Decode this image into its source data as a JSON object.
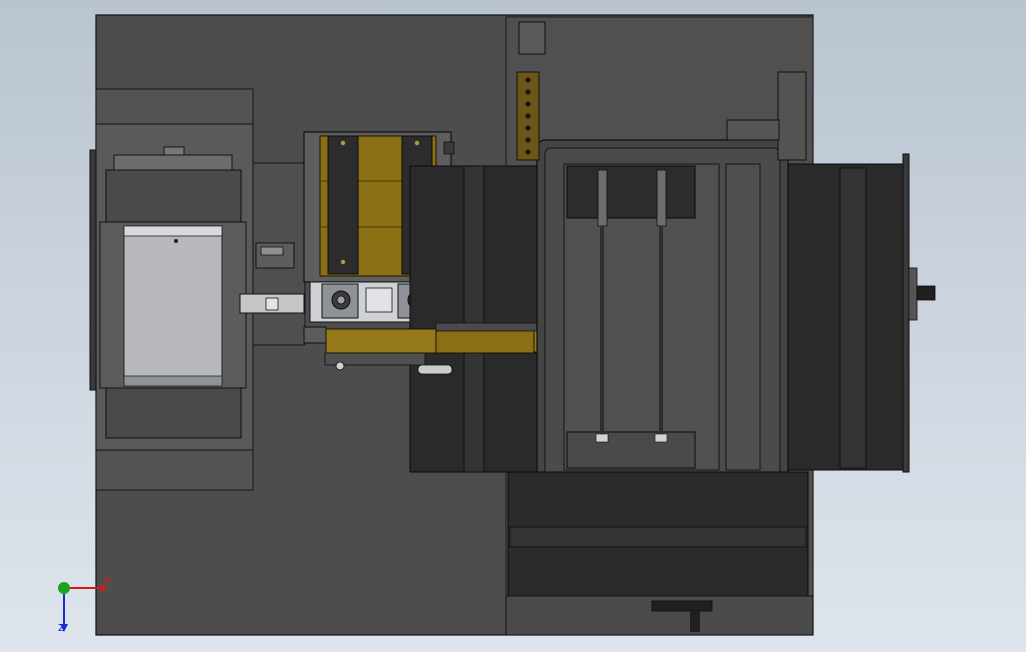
{
  "viewport": {
    "background_top": "#b9c4d1",
    "background_bottom": "#dfe5ec"
  },
  "colors": {
    "base_plate": "#4d4d4d",
    "dark_block": "#2c2c2c",
    "gold": "#8a6f14",
    "light_metal": "#c9cbce",
    "edge": "#101010"
  },
  "triad": {
    "x_label": "X",
    "z_label": "Z",
    "x_color": "#d11b1b",
    "y_color": "#1fa31f",
    "z_color": "#1a2ad6"
  }
}
